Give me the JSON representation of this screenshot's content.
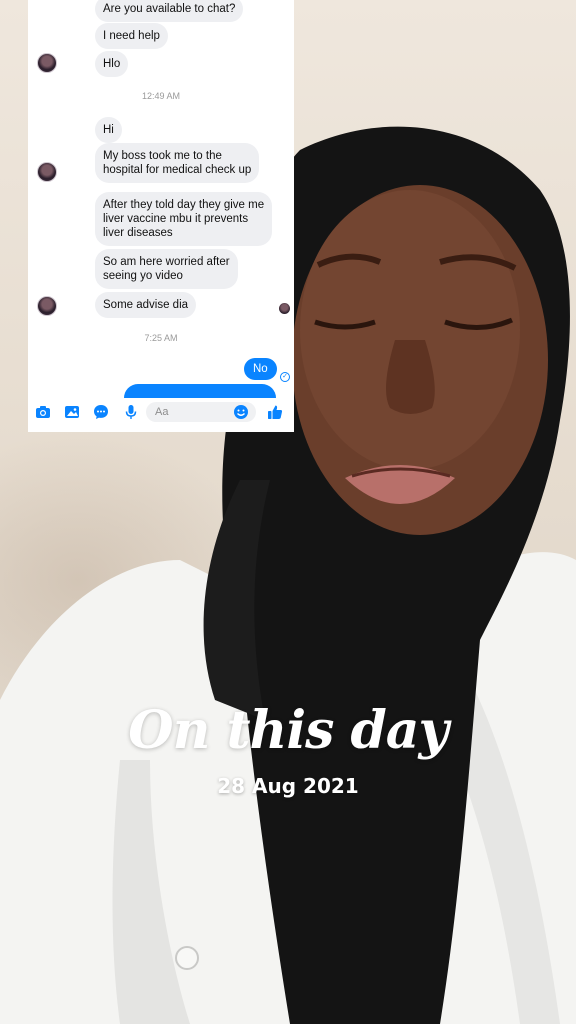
{
  "chat": {
    "messages": [
      {
        "text": "Are you available to chat?"
      },
      {
        "text": "I need help"
      },
      {
        "text": "Hlo"
      },
      {
        "text": "Hi"
      },
      {
        "text": "My boss took me to the\nhospital for medical check up"
      },
      {
        "text": "After they told day they give me\nliver vaccine mbu it prevents\nliver diseases"
      },
      {
        "text": "So am here worried after\nseeing yo video"
      },
      {
        "text": "Some advise dia"
      }
    ],
    "timestamps": [
      "12:49 AM",
      "7:25 AM"
    ],
    "sent_message": "No",
    "composer_placeholder": "Aa",
    "accent_color": "#0a84ff"
  },
  "overlay": {
    "title": "On this day",
    "date": "28 Aug 2021"
  }
}
